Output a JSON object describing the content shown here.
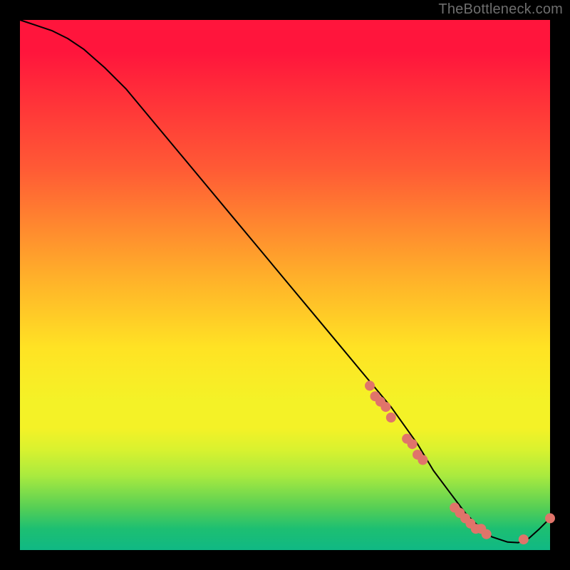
{
  "attribution": "TheBottleneck.com",
  "colors": {
    "background": "#000000",
    "dot": "#e0746a",
    "curve": "#000000"
  },
  "chart_data": {
    "type": "line",
    "title": "",
    "xlabel": "",
    "ylabel": "",
    "xlim": [
      0,
      100
    ],
    "ylim": [
      0,
      100
    ],
    "grid": false,
    "series": [
      {
        "name": "curve",
        "x": [
          0,
          3,
          6,
          9,
          12,
          16,
          20,
          25,
          30,
          35,
          40,
          45,
          50,
          55,
          60,
          65,
          70,
          75,
          78,
          81,
          84,
          86,
          89,
          92,
          94,
          96,
          98,
          100
        ],
        "y": [
          100,
          99,
          98,
          96.5,
          94.5,
          91,
          87,
          81,
          75,
          69,
          63,
          57,
          51,
          45,
          39,
          33,
          27,
          20,
          15,
          11,
          7,
          5,
          2.5,
          1.5,
          1.4,
          2.2,
          4,
          6
        ]
      }
    ],
    "points": [
      {
        "x": 66,
        "y": 31
      },
      {
        "x": 67,
        "y": 29
      },
      {
        "x": 68,
        "y": 28
      },
      {
        "x": 69,
        "y": 27
      },
      {
        "x": 70,
        "y": 25
      },
      {
        "x": 73,
        "y": 21
      },
      {
        "x": 74,
        "y": 20
      },
      {
        "x": 75,
        "y": 18
      },
      {
        "x": 76,
        "y": 17
      },
      {
        "x": 82,
        "y": 8
      },
      {
        "x": 83,
        "y": 7
      },
      {
        "x": 84,
        "y": 6
      },
      {
        "x": 85,
        "y": 5
      },
      {
        "x": 86,
        "y": 4
      },
      {
        "x": 87,
        "y": 4
      },
      {
        "x": 88,
        "y": 3
      },
      {
        "x": 95,
        "y": 2
      },
      {
        "x": 100,
        "y": 6
      }
    ]
  }
}
